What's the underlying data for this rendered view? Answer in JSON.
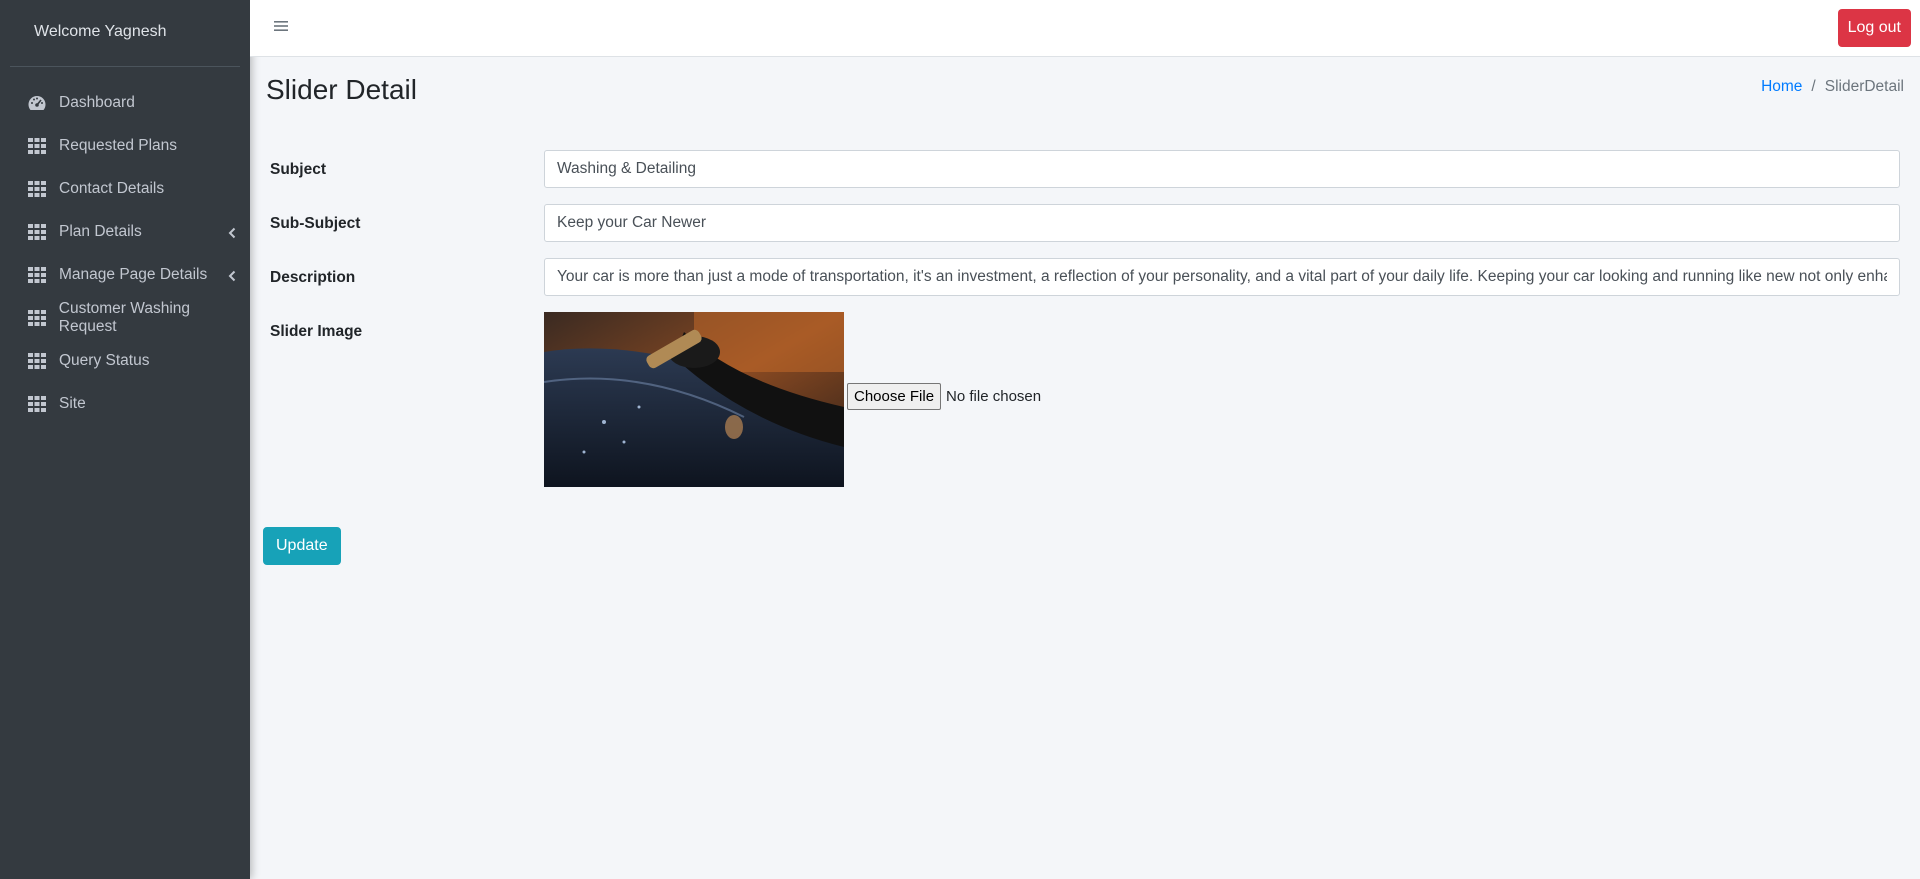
{
  "sidebar": {
    "brand": "Welcome Yagnesh",
    "items": [
      {
        "label": "Dashboard",
        "icon": "tachometer-icon",
        "has_caret": false
      },
      {
        "label": "Requested Plans",
        "icon": "grid-icon",
        "has_caret": false
      },
      {
        "label": "Contact Details",
        "icon": "grid-icon",
        "has_caret": false
      },
      {
        "label": "Plan Details",
        "icon": "grid-icon",
        "has_caret": true
      },
      {
        "label": "Manage Page Details",
        "icon": "grid-icon",
        "has_caret": true
      },
      {
        "label": "Customer Washing Request",
        "icon": "grid-icon",
        "has_caret": false
      },
      {
        "label": "Query Status",
        "icon": "grid-icon",
        "has_caret": false
      },
      {
        "label": "Site",
        "icon": "grid-icon",
        "has_caret": false
      }
    ]
  },
  "topbar": {
    "menu_icon": "hamburger-icon",
    "logout_label": "Log out"
  },
  "page": {
    "title": "Slider Detail",
    "breadcrumb": {
      "home": "Home",
      "current": "SliderDetail"
    }
  },
  "form": {
    "subject": {
      "label": "Subject",
      "value": "Washing & Detailing"
    },
    "sub_subject": {
      "label": "Sub-Subject",
      "value": "Keep your Car Newer"
    },
    "description": {
      "label": "Description",
      "value": "Your car is more than just a mode of transportation, it's an investment, a reflection of your personality, and a vital part of your daily life. Keeping your car looking and running like new not only enhances"
    },
    "slider_image": {
      "label": "Slider Image",
      "file_button": "Choose File",
      "file_status": "No file chosen"
    },
    "update_label": "Update"
  },
  "colors": {
    "sidebar_bg": "#343a40",
    "content_bg": "#f4f6f9",
    "logout": "#dc3545",
    "update": "#17a2b8",
    "link": "#007bff"
  }
}
